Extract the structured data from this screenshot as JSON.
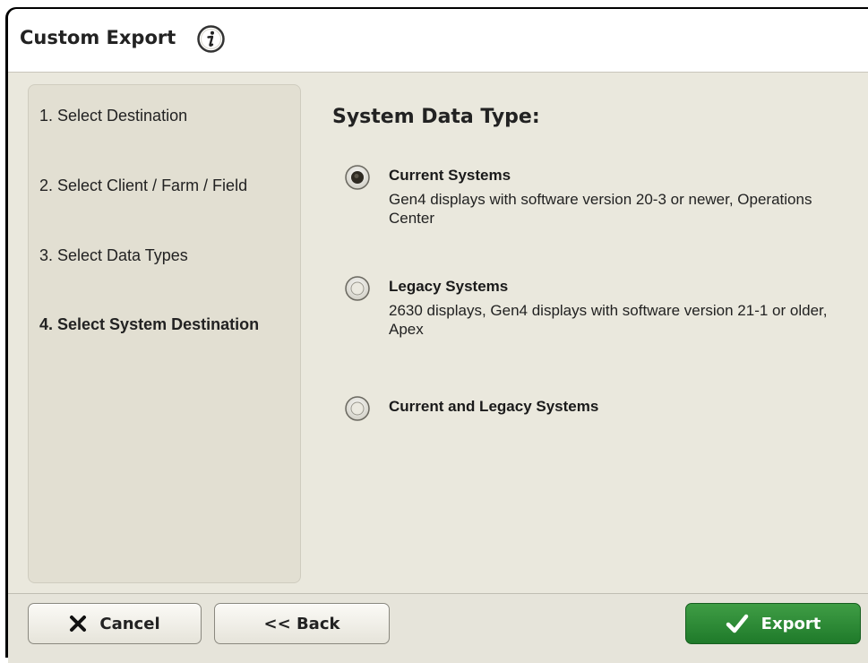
{
  "window": {
    "title": "Custom Export",
    "title_icon": "info-icon"
  },
  "steps": [
    {
      "label": "1. Select Destination",
      "active": false
    },
    {
      "label": "2. Select Client / Farm / Field",
      "active": false
    },
    {
      "label": "3. Select Data Types",
      "active": false
    },
    {
      "label": "4. Select System Destination",
      "active": true
    }
  ],
  "main": {
    "heading": "System Data Type:",
    "options": [
      {
        "label": "Current Systems",
        "description": "Gen4 displays with software version 20-3 or newer, Operations Center",
        "selected": true
      },
      {
        "label": "Legacy Systems",
        "description": "2630 displays, Gen4 displays with software version 21-1 or older, Apex",
        "selected": false
      },
      {
        "label": "Current and Legacy Systems",
        "description": "",
        "selected": false
      }
    ]
  },
  "footer": {
    "cancel_label": "Cancel",
    "back_label": "<< Back",
    "export_label": "Export"
  },
  "colors": {
    "accent_green": "#2a8a33",
    "panel_bg": "#eae8dd"
  }
}
